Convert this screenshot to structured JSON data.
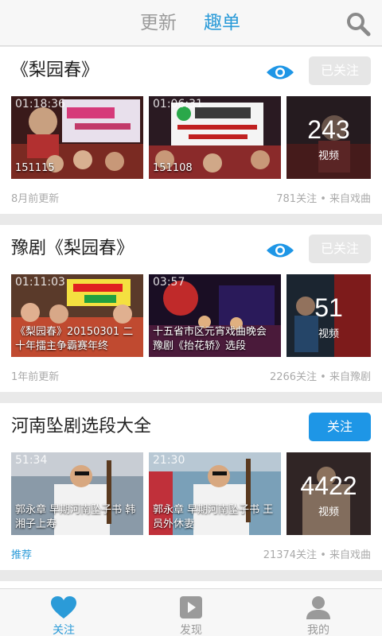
{
  "header": {
    "tabs": [
      {
        "label": "更新",
        "active": false
      },
      {
        "label": "趣单",
        "active": true
      }
    ]
  },
  "icons": {
    "search": "search-icon",
    "watch": "eye-icon",
    "follow_tab": "heart-icon",
    "discover_tab": "play-icon",
    "me_tab": "person-icon"
  },
  "colors": {
    "accent": "#2b9bd8",
    "follow_button": "#1e96e6",
    "followed_button": "#e6e6e6"
  },
  "cards": [
    {
      "title": "《梨园春》",
      "button": "已关注",
      "followed": true,
      "thumbs": [
        {
          "duration": "01:18:36",
          "caption": "151115"
        },
        {
          "duration": "01:06:31",
          "caption": "151108"
        }
      ],
      "video_count": "243",
      "video_label": "视频",
      "updated": "8月前更新",
      "stats": "781关注 • 来自戏曲"
    },
    {
      "title": "豫剧《梨园春》",
      "button": "已关注",
      "followed": true,
      "thumbs": [
        {
          "duration": "01:11:03",
          "caption": "《梨园春》20150301 二十年擂主争霸赛年终"
        },
        {
          "duration": "03:57",
          "caption": "十五省市区元宵戏曲晚会 豫剧《抬花轿》选段"
        }
      ],
      "video_count": "51",
      "video_label": "视频",
      "updated": "1年前更新",
      "stats": "2266关注 • 来自豫剧"
    },
    {
      "title": "河南坠剧选段大全",
      "button": "关注",
      "followed": false,
      "thumbs": [
        {
          "duration": "51:34",
          "caption": "郭永章 早期河南坠子书 韩湘子上寿"
        },
        {
          "duration": "21:30",
          "caption": "郭永章 早期河南坠子书 王员外休妻"
        }
      ],
      "video_count": "4422",
      "video_label": "视频",
      "updated": "推荐",
      "stats": "21374关注 • 来自戏曲"
    }
  ],
  "bottom_nav": [
    {
      "label": "关注",
      "active": true
    },
    {
      "label": "发现",
      "active": false
    },
    {
      "label": "我的",
      "active": false
    }
  ]
}
